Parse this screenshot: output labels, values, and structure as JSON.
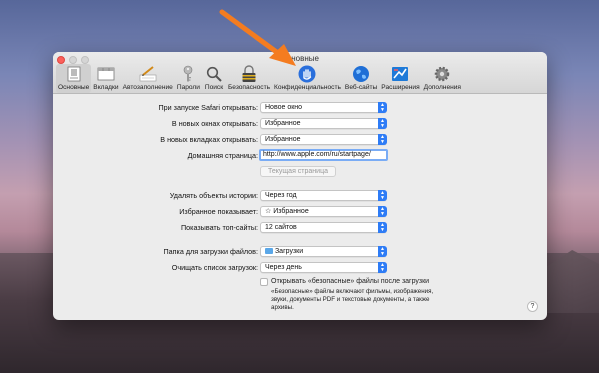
{
  "window": {
    "title": "Основные"
  },
  "toolbar": {
    "items": [
      {
        "label": "Основные",
        "icon": "general-icon"
      },
      {
        "label": "Вкладки",
        "icon": "tabs-icon"
      },
      {
        "label": "Автозаполнение",
        "icon": "autofill-icon"
      },
      {
        "label": "Пароли",
        "icon": "key-icon"
      },
      {
        "label": "Поиск",
        "icon": "magnifier-icon"
      },
      {
        "label": "Безопасность",
        "icon": "lock-icon"
      },
      {
        "label": "Конфиденциальность",
        "icon": "hand-icon"
      },
      {
        "label": "Веб-сайты",
        "icon": "globe-icon"
      },
      {
        "label": "Расширения",
        "icon": "puzzle-icon"
      },
      {
        "label": "Дополнения",
        "icon": "gear-icon"
      }
    ],
    "selected": "Основные"
  },
  "settings": {
    "open_with": {
      "label": "При запуске Safari открывать:",
      "value": "Новое окно"
    },
    "new_windows": {
      "label": "В новых окнах открывать:",
      "value": "Избранное"
    },
    "new_tabs": {
      "label": "В новых вкладках открывать:",
      "value": "Избранное"
    },
    "homepage": {
      "label": "Домашняя страница:",
      "value": "http://www.apple.com/ru/startpage/"
    },
    "set_current_button": "Текущая страница",
    "remove_history": {
      "label": "Удалять объекты истории:",
      "value": "Через год"
    },
    "favorites_shows": {
      "label": "Избранное показывает:",
      "value": "Избранное"
    },
    "top_sites": {
      "label": "Показывать топ-сайты:",
      "value": "12 сайтов"
    },
    "download_location": {
      "label": "Папка для загрузки файлов:",
      "value": "Загрузки"
    },
    "remove_downloads": {
      "label": "Очищать список загрузок:",
      "value": "Через день"
    },
    "open_safe_files": {
      "label": "Открывать «безопасные» файлы после загрузки",
      "checked": false,
      "description": [
        "«Безопасные» файлы включают фильмы, изображения,",
        "звуки, документы PDF и текстовые документы, а также",
        "архивы."
      ]
    }
  },
  "help_button": "?",
  "colors": {
    "accent": "#2e7cf6",
    "annotation_arrow": "#f47c20"
  }
}
